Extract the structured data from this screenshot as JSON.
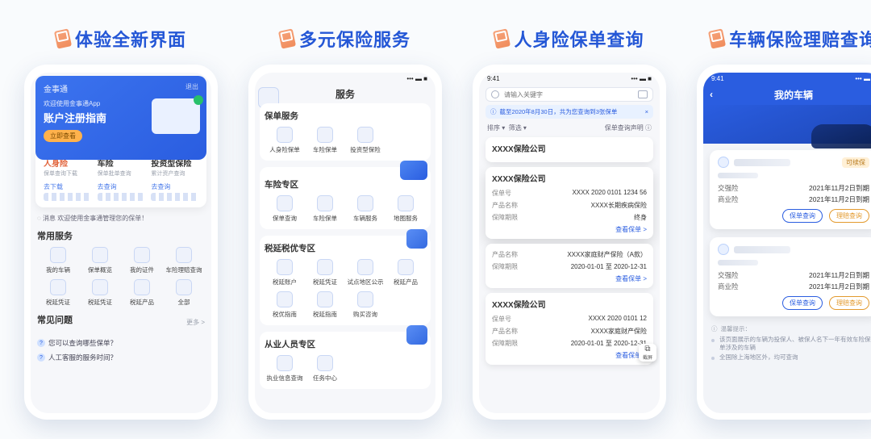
{
  "captions": [
    "体验全新界面",
    "多元保险服务",
    "人身险保单查询",
    "车辆保险理赔查询"
  ],
  "phone1": {
    "brand": "金事通",
    "logout": "退出",
    "hero_sub": "欢迎使用金事通App",
    "hero_title": "账户注册指南",
    "hero_btn": "立即查看",
    "tabs": [
      {
        "t": "人身险",
        "d": "保单查询下载",
        "link": "去下载"
      },
      {
        "t": "车险",
        "d": "保单批单查询",
        "link": "去查询"
      },
      {
        "t": "投资型保险",
        "d": "累计资产查询",
        "link": "去查询"
      }
    ],
    "notice_icon": "消息",
    "notice": "欢迎使用金事通管理您的保单！",
    "svc_title": "常用服务",
    "svc": [
      "我的车辆",
      "保单概览",
      "我的证件",
      "车险理赔查询",
      "税延凭证",
      "税延凭证",
      "税延产品",
      "全部"
    ],
    "faq_title": "常见问题",
    "more": "更多 >",
    "faq": [
      "您可以查询哪些保单？",
      "人工客服的服务时间？"
    ]
  },
  "phone2": {
    "title": "服务",
    "sec1": {
      "title": "保单服务",
      "items": [
        "人身险保单",
        "车险保单",
        "投资型保险"
      ]
    },
    "sec2": {
      "title": "车险专区",
      "items": [
        "保单查询",
        "车险保单",
        "车辆服务",
        "地图服务"
      ]
    },
    "sec3": {
      "title": "税延税优专区",
      "items": [
        "税延账户",
        "税延凭证",
        "试点地区公示",
        "税延产品",
        "税优指南",
        "税延指南",
        "购买咨询"
      ]
    },
    "sec4": {
      "title": "从业人员专区",
      "items": [
        "执业信息查询",
        "任务中心"
      ]
    }
  },
  "phone3": {
    "time": "9:41",
    "search_ph": "请输入关键字",
    "info": "截至2020年8月30日，共为您查询到3张保单",
    "close": "×",
    "sort": [
      "排序 ▾",
      "筛选 ▾"
    ],
    "decl": "保单查询声明 ⓘ",
    "company": "XXXX保险公司",
    "k_policy": "保单号",
    "k_product": "产品名称",
    "k_period": "保障期限",
    "pop": {
      "policy": "XXXX 2020 0101 1234 56",
      "product": "XXXX长期疾病保险",
      "period": "终身"
    },
    "view": "查看保单 >",
    "c2": {
      "product": "XXXX家庭财产保险（A款）",
      "period": "2020-01-01 至 2020-12-31"
    },
    "c3": {
      "policy": "XXXX 2020 0101 12",
      "product": "XXXX家庭财产保险",
      "period": "2020-01-01 至 2020-12-31"
    },
    "shot": "截屏"
  },
  "phone4": {
    "time": "9:41",
    "title": "我的车辆",
    "badge": "可续保",
    "rows": [
      {
        "lab": "交强险",
        "val": "2021年11月2日到期"
      },
      {
        "lab": "商业险",
        "val": "2021年11月2日到期"
      }
    ],
    "btn_policy": "保单查询",
    "btn_claim": "理赔查询",
    "tips_title": "温馨提示：",
    "tips": [
      "该页面展示的车辆为投保人、被保人名下一年有效车险保单涉及的车辆",
      "全国除上海地区外，均可查询"
    ]
  }
}
